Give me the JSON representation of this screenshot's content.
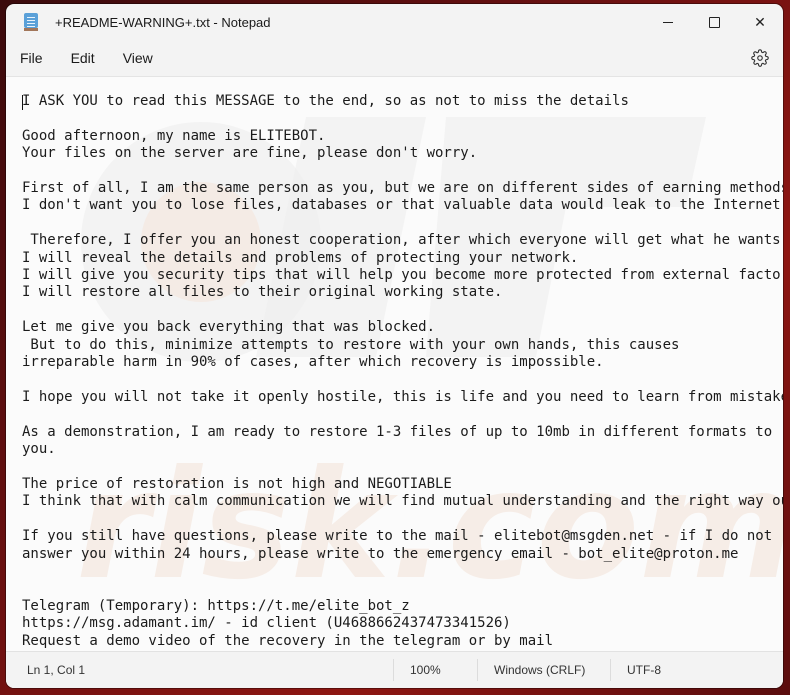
{
  "window": {
    "title": "+README-WARNING+.txt - Notepad",
    "app_icon": "notepad-icon",
    "controls": {
      "minimize": "minimize-icon",
      "maximize": "maximize-icon",
      "close": "close-icon",
      "close_glyph": "✕"
    }
  },
  "menu": {
    "items": [
      {
        "label": "File"
      },
      {
        "label": "Edit"
      },
      {
        "label": "View"
      }
    ],
    "settings_icon": "gear-icon"
  },
  "editor": {
    "lines": [
      "I ASK YOU to read this MESSAGE to the end, so as not to miss the details",
      "",
      "Good afternoon, my name is ELITEBOT.",
      "Your files on the server are fine, please don't worry.",
      "",
      "First of all, I am the same person as you, but we are on different sides of earning methods.",
      "I don't want you to lose files, databases or that valuable data would leak to the Internet.",
      "",
      " Therefore, I offer you an honest cooperation, after which everyone will get what he wants.",
      "I will reveal the details and problems of protecting your network.",
      "I will give you security tips that will help you become more protected from external factors.",
      "I will restore all files to their original working state.",
      "",
      "Let me give you back everything that was blocked.",
      " But to do this, minimize attempts to restore with your own hands, this causes",
      "irreparable harm in 90% of cases, after which recovery is impossible.",
      "",
      "I hope you will not take it openly hostile, this is life and you need to learn from mistakes.",
      "",
      "As a demonstration, I am ready to restore 1-3 files of up to 10mb in different formats to",
      "you.",
      "",
      "The price of restoration is not high and NEGOTIABLE",
      "I think that with calm communication we will find mutual understanding and the right way out.",
      "",
      "If you still have questions, please write to the mail - elitebot@msgden.net - if I do not",
      "answer you within 24 hours, please write to the emergency email - bot_elite@proton.me",
      "",
      "",
      "Telegram (Temporary): https://t.me/elite_bot_z",
      "https://msg.adamant.im/ - id client (U4688662437473341526)",
      "Request a demo video of the recovery in the telegram or by mail"
    ]
  },
  "statusbar": {
    "position": "Ln 1, Col 1",
    "zoom": "100%",
    "line_ending": "Windows (CRLF)",
    "encoding": "UTF-8"
  },
  "colors": {
    "window_bg": "#f3f3f3",
    "editor_bg": "#fbfbfb",
    "desktop_accent": "#8e1612"
  }
}
